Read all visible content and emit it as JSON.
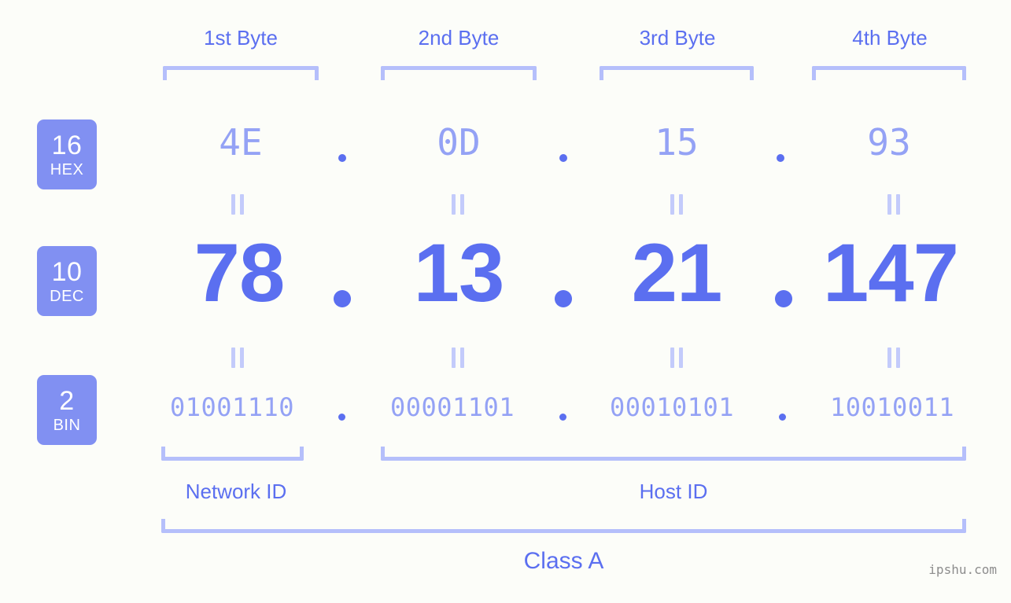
{
  "watermark": "ipshu.com",
  "byte_headers": [
    {
      "label": "1st Byte"
    },
    {
      "label": "2nd Byte"
    },
    {
      "label": "3rd Byte"
    },
    {
      "label": "4th Byte"
    }
  ],
  "rows": {
    "hex": {
      "badge_number": "16",
      "badge_unit": "HEX",
      "values": [
        "4E",
        "0D",
        "15",
        "93"
      ],
      "separator": "."
    },
    "dec": {
      "badge_number": "10",
      "badge_unit": "DEC",
      "values": [
        "78",
        "13",
        "21",
        "147"
      ],
      "separator": "."
    },
    "bin": {
      "badge_number": "2",
      "badge_unit": "BIN",
      "values": [
        "01001110",
        "00001101",
        "00010101",
        "10010011"
      ],
      "separator": "."
    }
  },
  "equality_marks": {
    "glyph": "॥",
    "count": 8
  },
  "segments": {
    "network_id": "Network ID",
    "host_id": "Host ID",
    "class": "Class A"
  },
  "colors": {
    "background": "#fcfdf9",
    "accent_strong": "#5b6ff0",
    "accent_light": "#94a2f5",
    "bracket": "#b5bffb",
    "badge_bg": "#8190f2",
    "badge_text": "#ffffff",
    "watermark_text": "#8d8d8d"
  },
  "ip_address": {
    "hex": "4E.0D.15.93",
    "decimal": "78.13.21.147",
    "binary": "01001110.00001101.00010101.10010011",
    "class": "Class A",
    "network_id_bytes": 1,
    "host_id_bytes": 3
  }
}
